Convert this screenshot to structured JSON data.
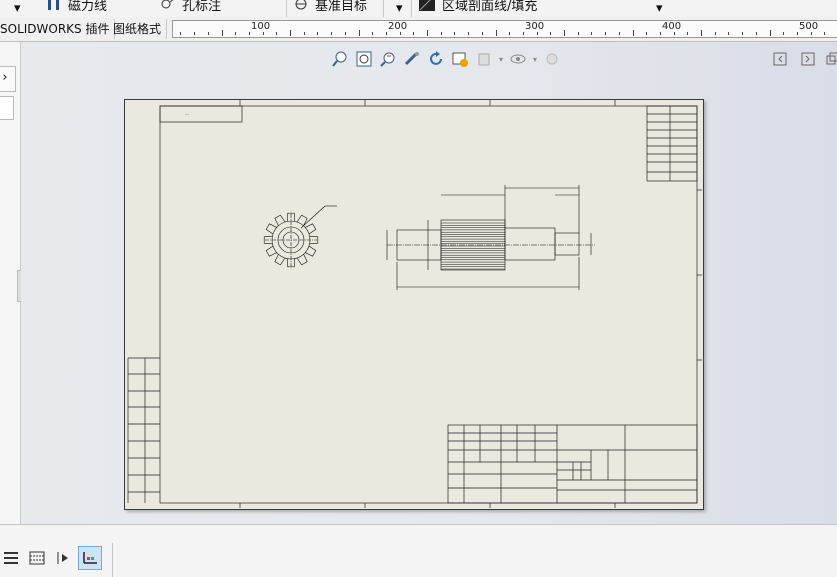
{
  "toolbar_top": {
    "items": [
      {
        "label": "磁力线"
      },
      {
        "label": "孔标注"
      },
      {
        "label": "基准目标"
      },
      {
        "label": "区域剖面线/填充"
      }
    ]
  },
  "tabs": [
    {
      "label": "SOLIDWORKS 插件"
    },
    {
      "label": "图纸格式"
    }
  ],
  "ruler": {
    "labels": [
      "100",
      "200",
      "300",
      "400",
      "500"
    ]
  },
  "hud_icons": [
    "zoom-to-fit-icon",
    "zoom-to-area-icon",
    "previous-view-icon",
    "rotate-icon",
    "redraw-icon",
    "view-settings-icon",
    "display-style-icon",
    "hide-show-icon",
    "appearance-icon"
  ],
  "window_controls": [
    "tile-left-icon",
    "tile-right-icon",
    "restore-icon"
  ],
  "drawing": {
    "background": "#e9e9df",
    "line_color": "#111111"
  },
  "bottom_icons": [
    "properties-list-icon",
    "layers-icon",
    "filter-icon",
    "sheet-format-icon"
  ]
}
